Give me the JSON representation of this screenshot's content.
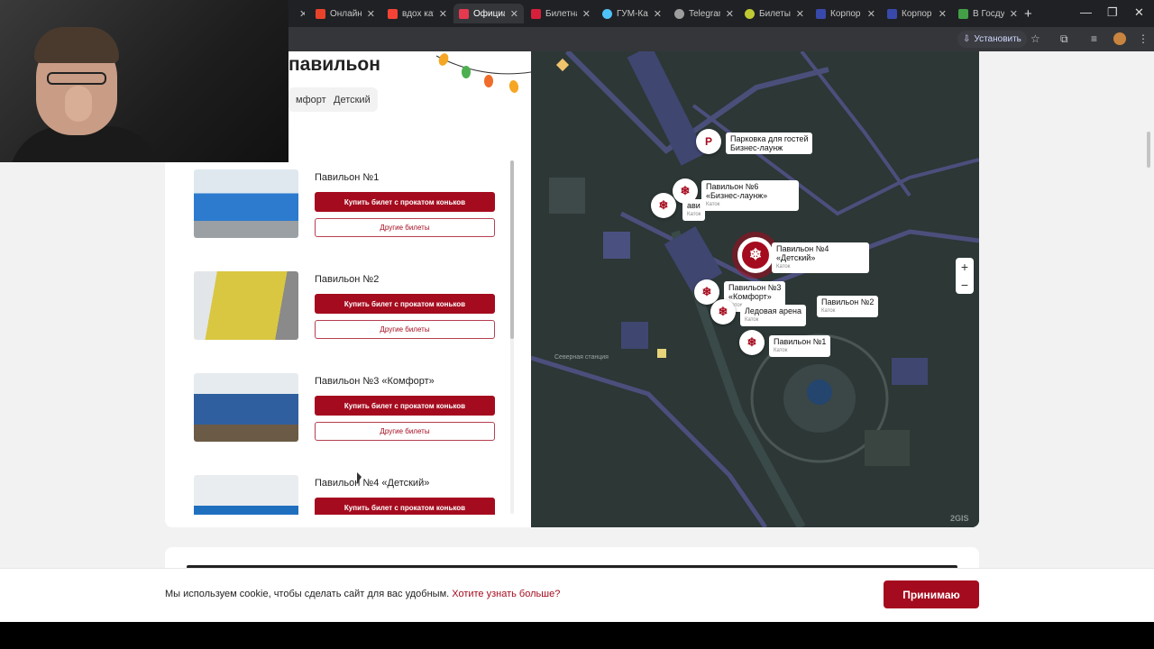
{
  "browser": {
    "tabs": [
      {
        "label": "",
        "color": "#5f6368"
      },
      {
        "label": "Онлайн",
        "color": "#e8432a"
      },
      {
        "label": "вдох кат",
        "color": "#f44336"
      },
      {
        "label": "Официа",
        "color": "#e53950",
        "active": true
      },
      {
        "label": "Билетна",
        "color": "#d6203b"
      },
      {
        "label": "ГУМ-Кат",
        "color": "#4fc3f7"
      },
      {
        "label": "Telegram",
        "color": "#9e9e9e"
      },
      {
        "label": "Билеты",
        "color": "#c0ca33"
      },
      {
        "label": "Корпор",
        "color": "#3949ab"
      },
      {
        "label": "Корпор",
        "color": "#3949ab"
      },
      {
        "label": "В Госду",
        "color": "#43a047"
      }
    ],
    "install_label": "Установить"
  },
  "page": {
    "heading": "павильон",
    "filters": [
      "мфорт",
      "Детский"
    ]
  },
  "pavilions": [
    {
      "title": "Павильон №1",
      "buy": "Купить билет с прокатом коньков",
      "other": "Другие билеты"
    },
    {
      "title": "Павильон №2",
      "buy": "Купить билет с прокатом коньков",
      "other": "Другие билеты"
    },
    {
      "title": "Павильон №3 «Комфорт»",
      "buy": "Купить билет с прокатом коньков",
      "other": "Другие билеты"
    },
    {
      "title": "Павильон №4 «Детский»",
      "buy": "Купить билет с прокатом коньков",
      "other": "Другие билеты"
    }
  ],
  "map": {
    "parking": {
      "line1": "Парковка для гостей",
      "line2": "Бизнес-лаунж",
      "icon": "P"
    },
    "p6": {
      "line1": "Павильон №6",
      "line2": "«Бизнес-лаунж»",
      "sub": "Каток"
    },
    "p5_partial": {
      "line1": "ави",
      "sub": "Каток"
    },
    "p4": {
      "line1": "Павильон №4",
      "line2": "«Детский»",
      "sub": "Каток"
    },
    "p3": {
      "line1": "Павильон №3",
      "line2": "«Комфорт»",
      "sub": "Каток"
    },
    "p2": {
      "line1": "Павильон №2",
      "sub": "Каток"
    },
    "arena": {
      "line1": "Ледовая арена",
      "sub": "Каток"
    },
    "p1": {
      "line1": "Павильон №1",
      "sub": "Каток"
    },
    "station": "Северная станция",
    "logo": "2GIS",
    "zoom_in": "+",
    "zoom_out": "−"
  },
  "cookie": {
    "text": "Мы используем cookie, чтобы сделать сайт для вас удобным.",
    "link": "Хотите узнать больше?",
    "accept": "Принимаю"
  },
  "colors": {
    "brand": "#a50b1e",
    "map_bg": "#2c3736"
  }
}
